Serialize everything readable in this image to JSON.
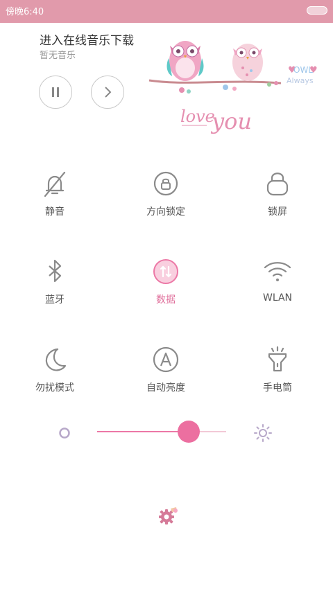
{
  "status_bar": {
    "time": "傍晚6:40"
  },
  "music": {
    "title": "进入在线音乐下载",
    "subtitle": "暂无音乐"
  },
  "art": {
    "owl_text": "OWL",
    "always_text": "Always",
    "love_text": "love",
    "you_text": "you"
  },
  "toggles": [
    {
      "label": "静音",
      "icon": "bell-off-icon",
      "active": false
    },
    {
      "label": "方向锁定",
      "icon": "rotation-lock-icon",
      "active": false
    },
    {
      "label": "锁屏",
      "icon": "lock-icon",
      "active": false
    },
    {
      "label": "蓝牙",
      "icon": "bluetooth-icon",
      "active": false
    },
    {
      "label": "数据",
      "icon": "mobile-data-icon",
      "active": true
    },
    {
      "label": "WLAN",
      "icon": "wifi-icon",
      "active": false
    },
    {
      "label": "勿扰模式",
      "icon": "moon-icon",
      "active": false
    },
    {
      "label": "自动亮度",
      "icon": "auto-brightness-icon",
      "active": false
    },
    {
      "label": "手电筒",
      "icon": "flashlight-icon",
      "active": false
    }
  ],
  "brightness": {
    "level": 0.71
  },
  "colors": {
    "accent": "#ec6fa0",
    "status_bar": "#e19aab",
    "icon_gray": "#8a8a8a",
    "active_text": "#e06f9b"
  }
}
